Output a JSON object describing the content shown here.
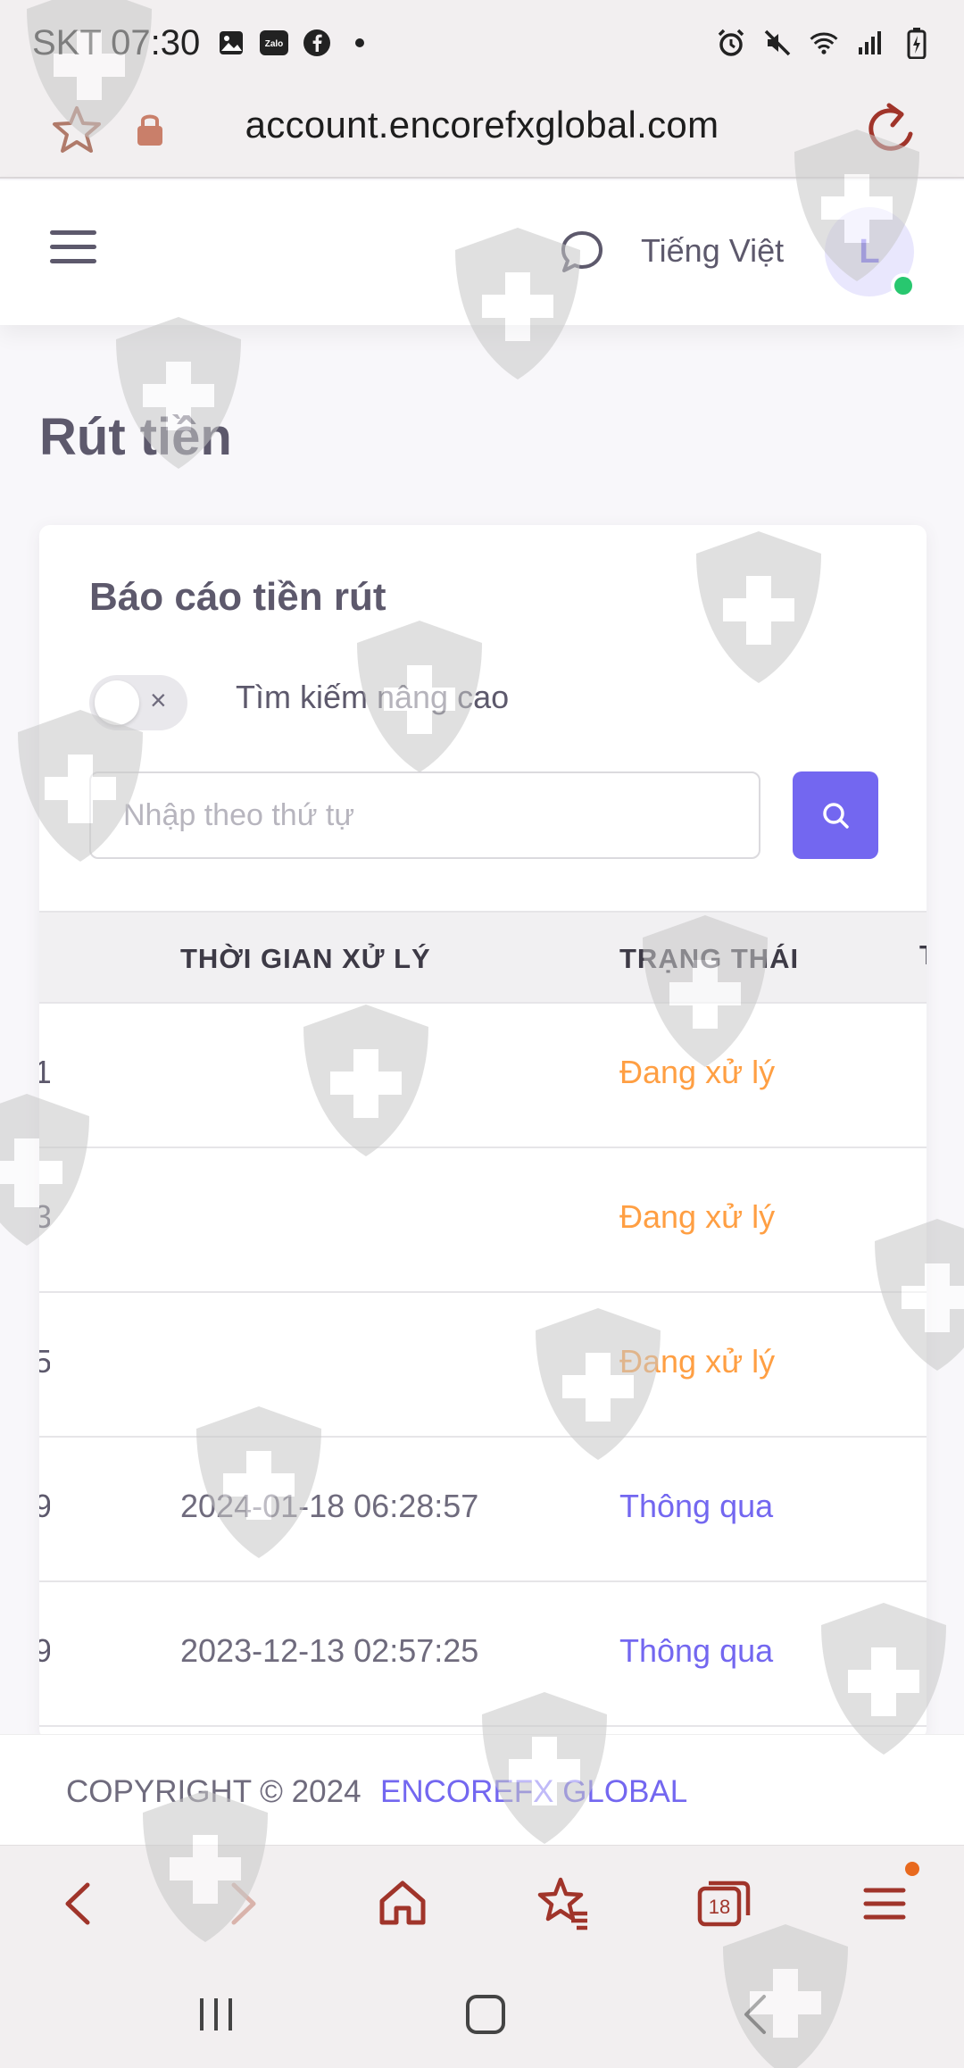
{
  "status_bar": {
    "time": "SKT 07:30",
    "left_icons": [
      "gallery-icon",
      "zalo-icon",
      "facebook-icon",
      "dot-icon"
    ],
    "right_icons": [
      "alarm-icon",
      "mute-icon",
      "wifi-icon",
      "signal-icon",
      "battery-icon"
    ],
    "zalo_text": "Zalo"
  },
  "browser": {
    "url": "account.encorefxglobal.com",
    "tab_count": "18"
  },
  "header": {
    "language": "Tiếng Việt",
    "avatar_initial": "L",
    "online_color": "#28c76f"
  },
  "page": {
    "title": "Rút tiền"
  },
  "card": {
    "title": "Báo cáo tiền rút",
    "toggle_state_symbol": "×",
    "advanced_search_label": "Tìm kiếm nâng cao",
    "search_placeholder": "Nhập theo thứ tự"
  },
  "table": {
    "columns": [
      "THỜI GIAN XỬ LÝ",
      "TRẠNG THÁI"
    ],
    "next_column_partial": "T",
    "rows": [
      {
        "clipped": "1",
        "processed_time": "",
        "status": "Đang xử lý",
        "status_color": "#ff9f43"
      },
      {
        "clipped": "3",
        "processed_time": "",
        "status": "Đang xử lý",
        "status_color": "#ff9f43"
      },
      {
        "clipped": "5",
        "processed_time": "",
        "status": "Đang xử lý",
        "status_color": "#ff9f43"
      },
      {
        "clipped": "9",
        "processed_time": "2024-01-18 06:28:57",
        "status": "Thông qua",
        "status_color": "#7367f0"
      },
      {
        "clipped": "9",
        "processed_time": "2023-12-13 02:57:25",
        "status": "Thông qua",
        "status_color": "#7367f0"
      }
    ]
  },
  "footer": {
    "copyright": "COPYRIGHT © 2024",
    "brand": "ENCOREFX GLOBAL"
  },
  "colors": {
    "accent": "#7367f0",
    "pending": "#ff9f43",
    "browser_icon": "#a0342a"
  }
}
